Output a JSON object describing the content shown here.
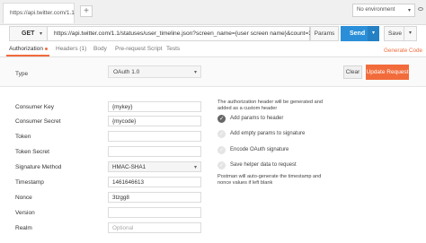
{
  "tabs": {
    "request_tab_label": "https://api.twitter.com/1.1",
    "add_tab_label": "+",
    "environment": "No environment"
  },
  "request": {
    "method": "GET",
    "url": "https://api.twitter.com/1.1/statuses/user_timeline.json?screen_name={user screen name}&count=30",
    "params_label": "Params",
    "send_label": "Send",
    "save_label": "Save"
  },
  "subtabs": {
    "authorization": "Authorization",
    "headers": "Headers (1)",
    "body": "Body",
    "prerequest": "Pre-request Script",
    "tests": "Tests",
    "generate_code": "Generate Code"
  },
  "auth": {
    "type_label": "Type",
    "type_value": "OAuth 1.0",
    "clear_label": "Clear",
    "update_label": "Update Request",
    "fields": [
      {
        "label": "Consumer Key",
        "value": "{mykey}"
      },
      {
        "label": "Consumer Secret",
        "value": "{mycode}"
      },
      {
        "label": "Token",
        "value": ""
      },
      {
        "label": "Token Secret",
        "value": ""
      },
      {
        "label": "Signature Method",
        "value": "HMAC-SHA1"
      },
      {
        "label": "Timestamp",
        "value": "1461646613"
      },
      {
        "label": "Nonce",
        "value": "3tzgg8"
      },
      {
        "label": "Version",
        "value": ""
      },
      {
        "label": "Realm",
        "value": "Optional"
      }
    ],
    "note_top": "The authorization header will be generated and added as a custom header",
    "options": [
      {
        "label": "Add params to header",
        "checked": true
      },
      {
        "label": "Add empty params to signature",
        "checked": false
      },
      {
        "label": "Encode OAuth signature",
        "checked": false
      },
      {
        "label": "Save helper data to request",
        "checked": false
      }
    ],
    "note_bottom": "Postman will auto-generate the timestamp and nonce values if left blank"
  },
  "colors": {
    "accent": "#f26b3a",
    "send": "#2a8fd8"
  }
}
